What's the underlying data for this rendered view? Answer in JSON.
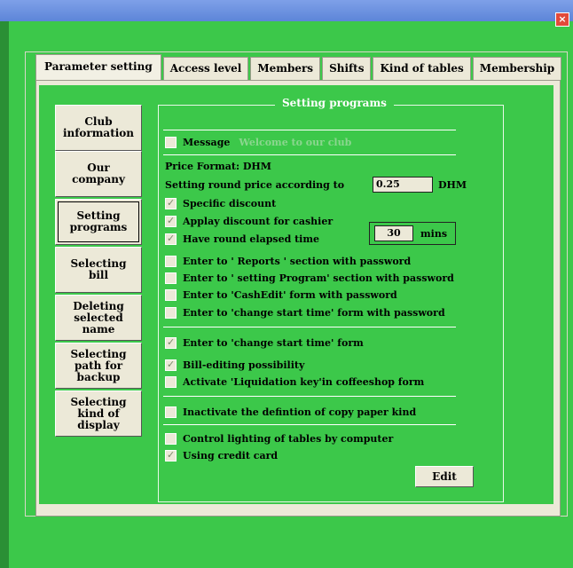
{
  "window": {
    "close_glyph": "×"
  },
  "tabs": [
    {
      "label": "Parameter setting",
      "active": true
    },
    {
      "label": "Access level"
    },
    {
      "label": "Members"
    },
    {
      "label": "Shifts"
    },
    {
      "label": "Kind of tables"
    },
    {
      "label": "Membership"
    }
  ],
  "sidebar": {
    "items": [
      {
        "label": "Club information"
      },
      {
        "label": "Our company"
      },
      {
        "label": "Setting programs",
        "selected": true
      },
      {
        "label": "Selecting bill"
      },
      {
        "label": "Deleting selected name"
      },
      {
        "label": "Selecting path for backup"
      },
      {
        "label": "Selecting kind of display"
      }
    ]
  },
  "settings": {
    "group_title": "Setting programs",
    "message_label": "Message",
    "message_value": "Welcome to our club",
    "price_format": "Price Format: DHM",
    "round_price_label": "Setting round price according to",
    "round_price_value": "0.25",
    "round_price_unit": "DHM",
    "specific_discount": "Specific discount",
    "cashier_discount": "Applay discount for cashier",
    "round_elapsed": "Have round elapsed time",
    "elapsed_value": "30",
    "elapsed_unit": "mins",
    "reports_pw": "Enter to ' Reports ' section with password",
    "setting_program_pw": "Enter to ' setting Program' section  with  password",
    "cashedit_pw": "Enter to 'CashEdit' form with password",
    "change_start_pw": "Enter to 'change start time' form with password",
    "change_start": "Enter to 'change start time' form",
    "bill_editing": "Bill-editing possibility",
    "liquidation_key": "Activate 'Liquidation key'in coffeeshop form",
    "inactivate_paper": "Inactivate the defintion of copy paper kind",
    "control_lighting": "Control lighting of tables by computer",
    "credit_card": "Using credit card",
    "edit_label": "Edit"
  }
}
